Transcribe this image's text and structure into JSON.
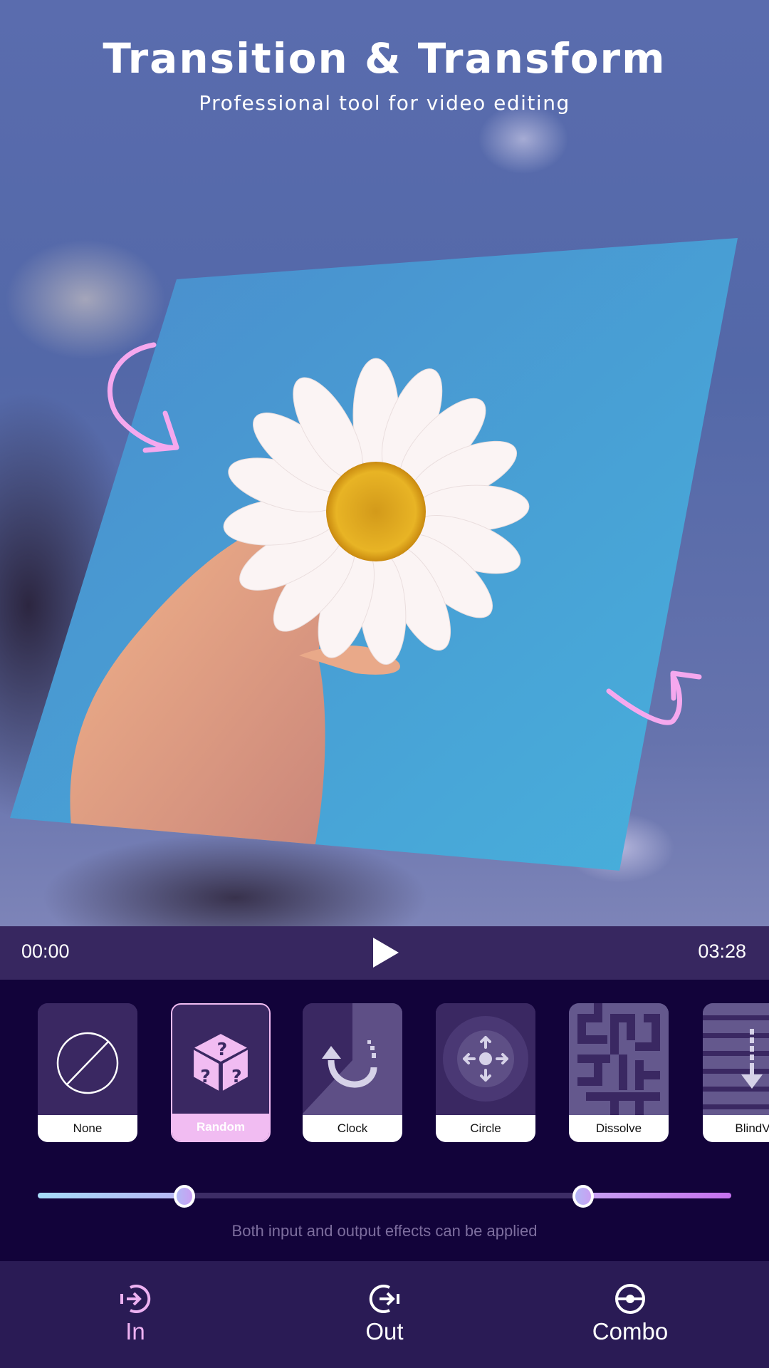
{
  "header": {
    "title": "Transition & Transform",
    "subtitle": "Professional tool for video editing"
  },
  "preview": {
    "subject": "hand holding white daisy against blue sky",
    "annotation_icons": [
      "curved-arrow-down-right",
      "curved-arrow-up"
    ],
    "annotation_color": "#f5a8ee"
  },
  "player": {
    "current_time": "00:00",
    "total_time": "03:28",
    "play_icon": "play-icon"
  },
  "effects": {
    "items": [
      {
        "label": "None",
        "icon": "no-effect-icon",
        "selected": false
      },
      {
        "label": "Random",
        "icon": "mystery-dice-icon",
        "selected": true
      },
      {
        "label": "Clock",
        "icon": "clock-rotate-icon",
        "selected": false
      },
      {
        "label": "Circle",
        "icon": "move-arrows-icon",
        "selected": false
      },
      {
        "label": "Dissolve",
        "icon": "maze-icon",
        "selected": false
      },
      {
        "label": "BlindV",
        "icon": "blinds-down-icon",
        "selected": false
      }
    ],
    "range_slider": {
      "in_fraction": 0.21,
      "out_fraction": 0.785
    },
    "hint": "Both input and output effects can be applied"
  },
  "bottom_nav": {
    "items": [
      {
        "label": "In",
        "icon": "enter-icon",
        "active": true
      },
      {
        "label": "Out",
        "icon": "exit-icon",
        "active": false
      },
      {
        "label": "Combo",
        "icon": "combo-icon",
        "active": false
      }
    ]
  },
  "colors": {
    "accent_pink": "#f1bcf2",
    "player_bar": "#372760",
    "panel_bg": "#12033a",
    "nav_bg": "#2a1b55"
  }
}
